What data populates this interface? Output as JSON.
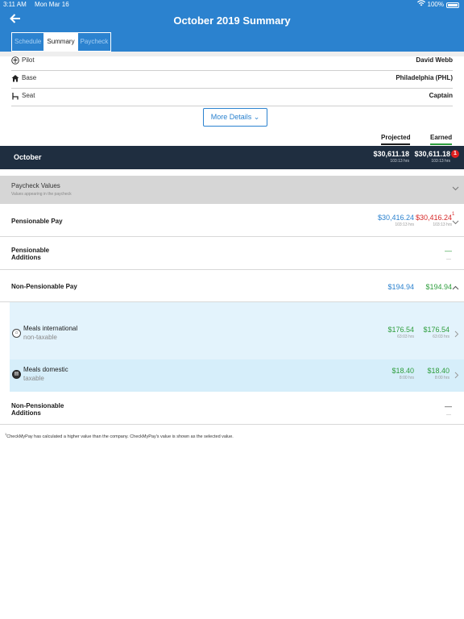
{
  "status": {
    "time": "3:11 AM",
    "date": "Mon Mar 16",
    "battery": "100%"
  },
  "header": {
    "title": "October 2019 Summary"
  },
  "tabs": [
    {
      "label": "Schedule",
      "active": false
    },
    {
      "label": "Summary",
      "active": true
    },
    {
      "label": "Paycheck",
      "active": false
    }
  ],
  "details": [
    {
      "icon": "pilot-icon",
      "label": "Pilot",
      "value": "David Webb"
    },
    {
      "icon": "home-icon",
      "label": "Base",
      "value": "Philadelphia (PHL)"
    },
    {
      "icon": "seat-icon",
      "label": "Seat",
      "value": "Captain"
    }
  ],
  "more_details": "More Details",
  "columns": {
    "projected": "Projected",
    "earned": "Earned"
  },
  "period": {
    "name": "October",
    "projected": "$30,611.18",
    "projected_hrs": "103:13 hrs",
    "earned": "$30,611.18",
    "earned_hrs": "103:13 hrs",
    "badge": "1"
  },
  "paycheck_values": {
    "title": "Paycheck Values",
    "subtitle": "Values appearing in the paycheck"
  },
  "pensionable_pay": {
    "label": "Pensionable Pay",
    "projected": "$30,416.24",
    "projected_hrs": "103:13 hrs",
    "earned": "$30,416.24",
    "earned_hrs": "103:13 hrs",
    "flag": "1"
  },
  "pensionable_additions": {
    "label_line1": "Pensionable",
    "label_line2": "Additions",
    "dash": "—",
    "sub_dash": "—"
  },
  "non_pensionable_pay": {
    "label": "Non-Pensionable Pay",
    "projected": "$194.94",
    "earned": "$194.94"
  },
  "items": [
    {
      "icon": "meals-international-icon",
      "name": "Meals international",
      "desc": "non-taxable",
      "projected": "$176.54",
      "projected_hrs": "63:03 hrs",
      "earned": "$176.54",
      "earned_hrs": "63:03 hrs"
    },
    {
      "icon": "meals-domestic-icon",
      "name": "Meals domestic",
      "desc": "taxable",
      "projected": "$18.40",
      "projected_hrs": "8:00 hrs",
      "earned": "$18.40",
      "earned_hrs": "8:00 hrs"
    }
  ],
  "non_pensionable_additions": {
    "label_line1": "Non-Pensionable",
    "label_line2": "Additions",
    "dash": "—",
    "sub_dash": "—"
  },
  "footnote": {
    "mark": "1",
    "text": "CheckMyPay has calculated a higher value than the company. CheckMyPay's value is shown as the selected value."
  }
}
